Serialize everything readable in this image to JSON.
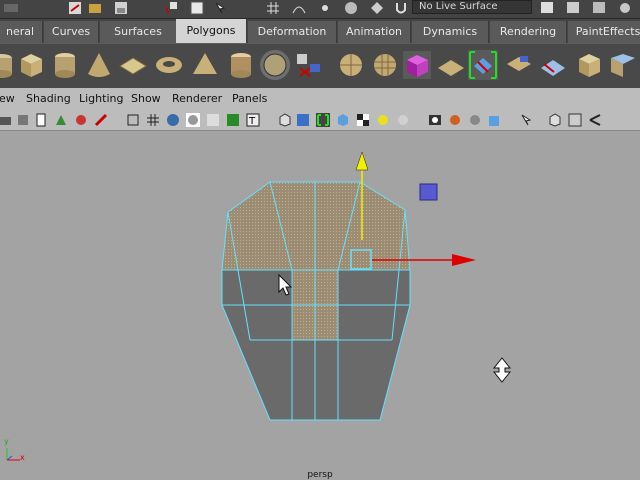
{
  "statusline": {
    "live_surface": "No Live Surface"
  },
  "shelf": {
    "tabs": [
      {
        "label": "neral",
        "active": false
      },
      {
        "label": "Curves",
        "active": false
      },
      {
        "label": "Surfaces",
        "active": false
      },
      {
        "label": "Polygons",
        "active": true
      },
      {
        "label": "Deformation",
        "active": false
      },
      {
        "label": "Animation",
        "active": false
      },
      {
        "label": "Dynamics",
        "active": false
      },
      {
        "label": "Rendering",
        "active": false
      },
      {
        "label": "PaintEffects",
        "active": false
      }
    ],
    "icons": [
      "poly-cylinder-icon",
      "poly-cube-icon",
      "poly-cylinder-icon",
      "poly-cone-icon",
      "poly-plane-icon",
      "poly-torus-icon",
      "poly-pyramid-icon",
      "poly-pipe-icon",
      "poly-helix-icon",
      "poly-separate-icon",
      "poly-sphere-icon",
      "poly-sphere-icon",
      "poly-prism-icon",
      "poly-combine-icon",
      "poly-extrude-icon",
      "poly-append-icon",
      "poly-split-icon",
      "poly-bevel-icon",
      "poly-merge-icon"
    ]
  },
  "panel_menu": {
    "items": [
      "ew",
      "Shading",
      "Lighting",
      "Show",
      "Renderer",
      "Panels"
    ]
  },
  "viewport": {
    "camera_label": "persp",
    "axis_labels": {
      "y": "y",
      "x": "x"
    }
  },
  "colors": {
    "wire": "#66e0ff",
    "face_selected": "#a8987c",
    "face": "#686868",
    "y_axis": "#f0f000",
    "x_axis": "#dd0000"
  }
}
